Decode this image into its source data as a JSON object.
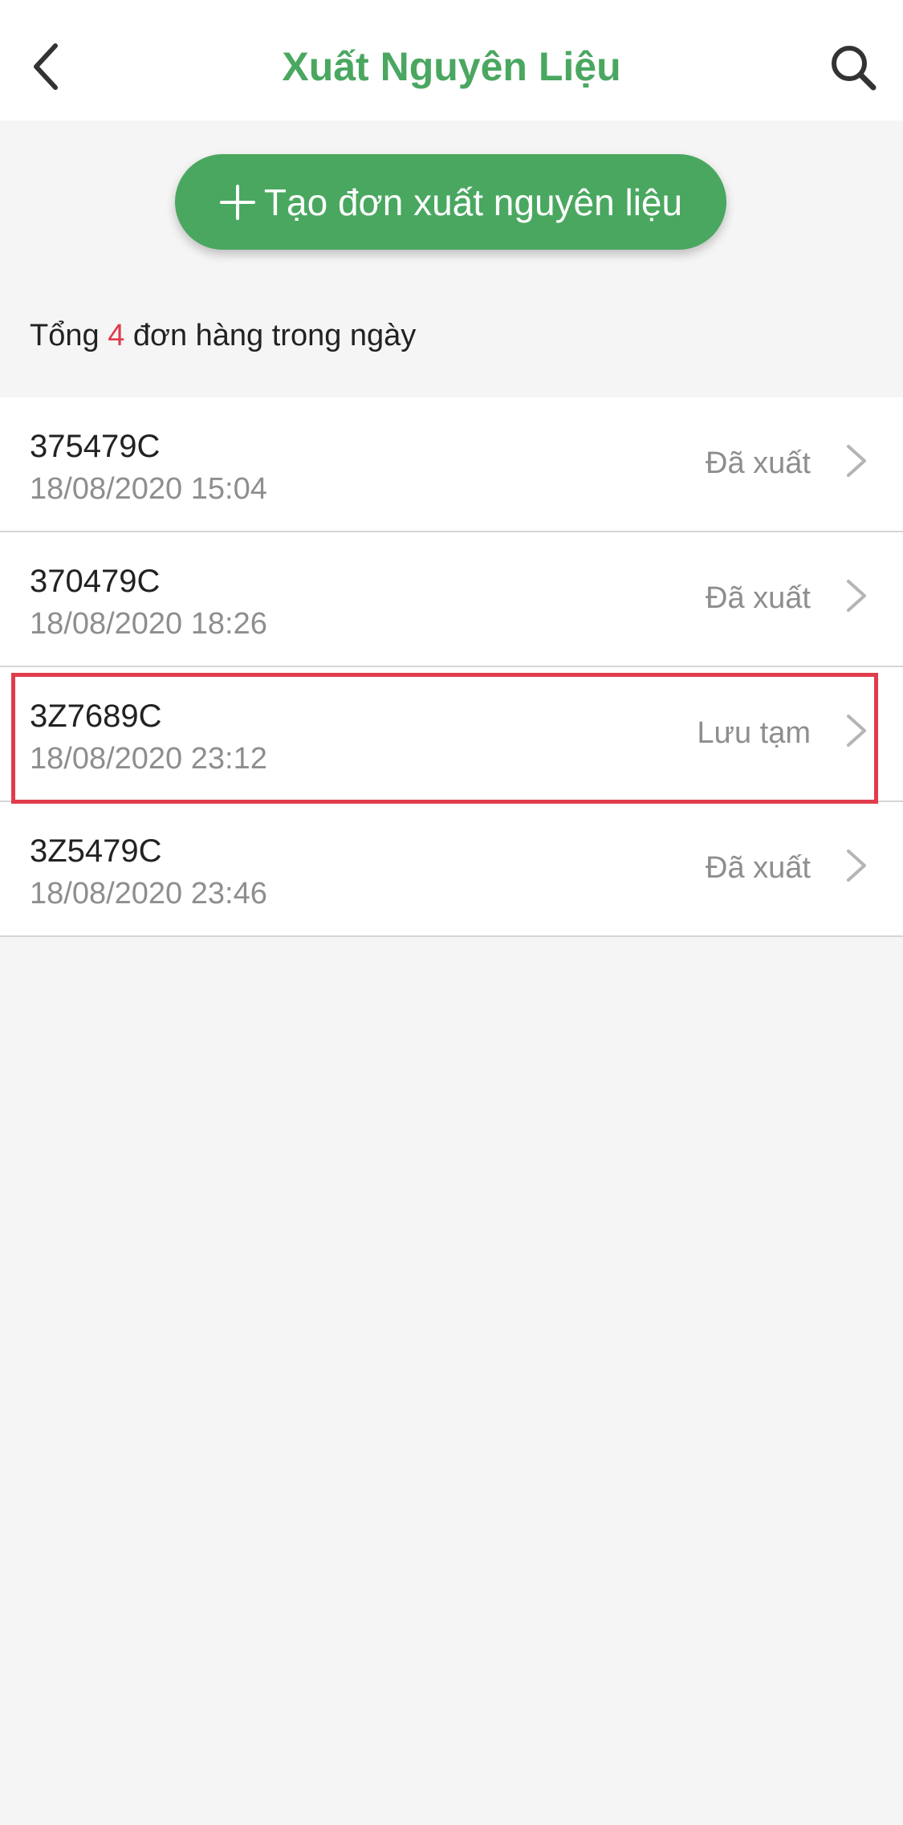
{
  "colors": {
    "brand_green": "#4aa760",
    "count_red": "#e03c4b",
    "highlight_red": "#e03c4b",
    "icon_dark": "#333333"
  },
  "header": {
    "back_icon": "chevron-left-icon",
    "title": "Xuất Nguyên Liệu",
    "search_icon": "search-icon"
  },
  "create_button": {
    "icon": "plus-icon",
    "label": "Tạo đơn xuất nguyên liệu"
  },
  "summary": {
    "prefix": "Tổng",
    "count": "4",
    "suffix": "đơn hàng trong ngày"
  },
  "orders": [
    {
      "code": "375479C",
      "datetime": "18/08/2020 15:04",
      "status": "Đã xuất",
      "highlighted": false
    },
    {
      "code": "370479C",
      "datetime": "18/08/2020 18:26",
      "status": "Đã xuất",
      "highlighted": false
    },
    {
      "code": "3Z7689C",
      "datetime": "18/08/2020 23:12",
      "status": "Lưu tạm",
      "highlighted": true
    },
    {
      "code": "3Z5479C",
      "datetime": "18/08/2020 23:46",
      "status": "Đã xuất",
      "highlighted": false
    }
  ]
}
